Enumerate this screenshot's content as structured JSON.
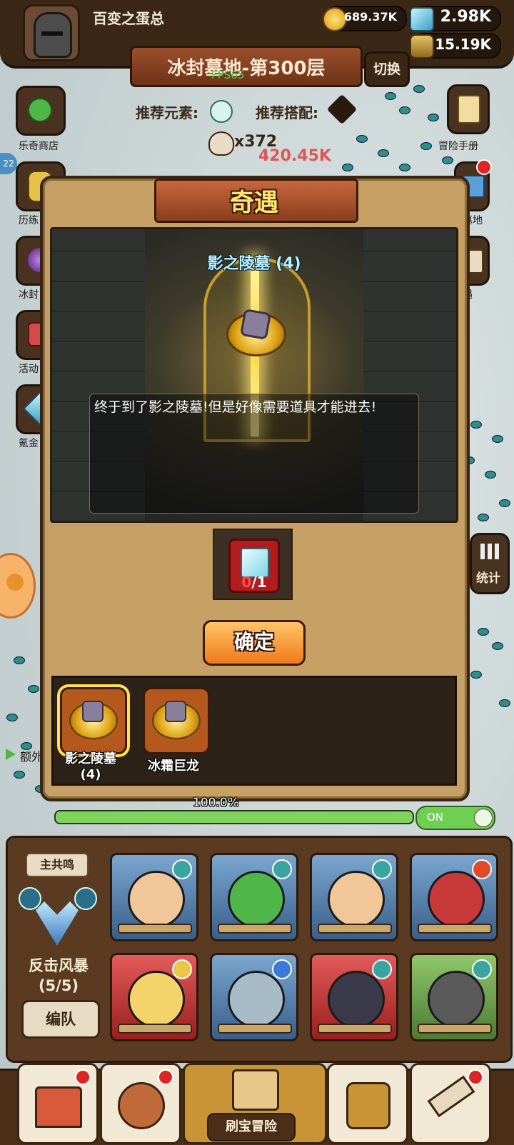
{
  "player": {
    "name": "百变之蛋总"
  },
  "resources": {
    "gold": "689.37K",
    "gems": "2.98K",
    "potion": "15.19K"
  },
  "level": {
    "title": "冰封墓地-第300层",
    "fps": "FPS65",
    "switch_label": "切换"
  },
  "recommend": {
    "element_label": "推荐元素:",
    "combo_label": "推荐搭配:"
  },
  "kills": {
    "count": "x372",
    "damage": "420.45K"
  },
  "side_left": [
    {
      "label": "乐奇商店",
      "icon": "clover-icon"
    },
    {
      "label": "历练",
      "icon": "vase-icon"
    },
    {
      "label": "冰封",
      "icon": "orb-icon"
    },
    {
      "label": "活动",
      "icon": "gift-icon"
    },
    {
      "label": "氪金",
      "icon": "diamond-icon"
    }
  ],
  "side_right": [
    {
      "label": "冒险手册",
      "icon": "scroll-icon"
    },
    {
      "label": "墓地",
      "icon": "crate-icon"
    },
    {
      "label": "遇",
      "icon": "quest-icon"
    },
    {
      "label": "统计",
      "icon": "bar-chart-icon"
    }
  ],
  "side_badge": "22",
  "extra_label": "额外",
  "modal": {
    "title": "奇遇",
    "scene_title": "影之陵墓 (4)",
    "description": "终于到了影之陵墓!但是好像需要道具才能进去!",
    "required_item": {
      "icon": "gem-chest-icon",
      "current": "0",
      "total": "/1"
    },
    "confirm_label": "确定",
    "events": [
      {
        "label": "影之陵墓\n(4)",
        "selected": true
      },
      {
        "label": "冰霜巨龙",
        "selected": false
      }
    ]
  },
  "progress": {
    "text": "100.0%",
    "value": 1.0,
    "toggle_label": "ON"
  },
  "team": {
    "leader_chip": "主共鸣",
    "leader_name": "反击风暴",
    "leader_count": "(5/5)",
    "formation_label": "编队",
    "heroes": [
      {
        "color": "blue",
        "element": "wind"
      },
      {
        "color": "blue",
        "element": "wind"
      },
      {
        "color": "blue",
        "element": "wind"
      },
      {
        "color": "blue",
        "element": "fire"
      },
      {
        "color": "red",
        "element": "light"
      },
      {
        "color": "blue",
        "element": "water"
      },
      {
        "color": "red",
        "element": "wind"
      },
      {
        "color": "green",
        "element": "wind"
      }
    ]
  },
  "bottom_nav": {
    "items": [
      {
        "name": "shop",
        "icon": "shop-icon",
        "badge": true
      },
      {
        "name": "heroes",
        "icon": "hero-icon",
        "badge": true
      },
      {
        "name": "treasure-adventure",
        "icon": "map-icon",
        "label": "刷宝冒险",
        "active": true
      },
      {
        "name": "bag",
        "icon": "backpack-icon",
        "badge": false
      },
      {
        "name": "forge",
        "icon": "hammer-icon",
        "badge": true
      }
    ]
  },
  "colors": {
    "accent": "#f07a18",
    "title_yellow": "#ffe46e",
    "panel_brown": "#5a3b22"
  }
}
